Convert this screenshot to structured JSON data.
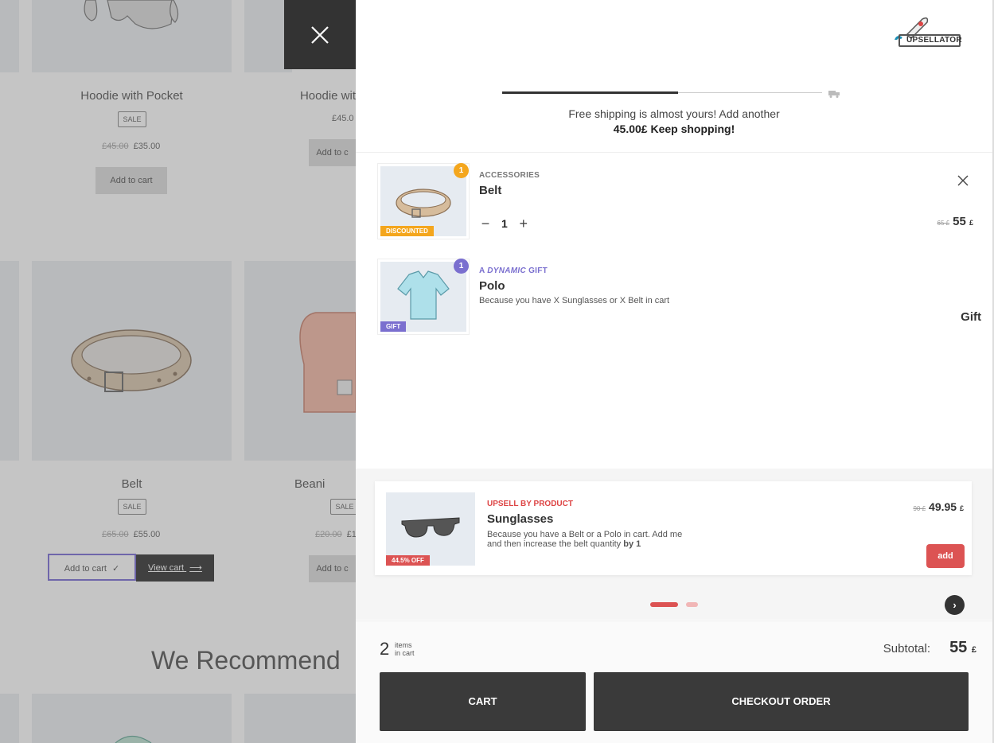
{
  "shop": {
    "products": [
      {
        "name": "Hoodie with Pocket",
        "badge": "SALE",
        "old_price": "£45.00",
        "price": "£35.00",
        "button": "Add to cart"
      },
      {
        "name": "Hoodie wit",
        "price": "£45.0",
        "button": "Add to c"
      },
      {
        "name": "Belt",
        "badge": "SALE",
        "old_price": "£65.00",
        "price": "£55.00",
        "button": "Add to cart",
        "view_button": "View cart"
      },
      {
        "name": "Beani",
        "badge": "SALE",
        "old_price": "£20.00",
        "price": "£1",
        "button": "Add to c"
      }
    ],
    "section_title": "We Recommend"
  },
  "drawer": {
    "logo_text": "UPSELLATOR",
    "shipping": {
      "progress": 0.55,
      "line1": "Free shipping is almost yours! Add another",
      "line2": "45.00£ Keep shopping!"
    },
    "items": [
      {
        "category": "ACCESSORIES",
        "name": "Belt",
        "qty": "1",
        "ribbon": "DISCOUNTED",
        "old_price": "65 £",
        "price": "55",
        "currency": "£",
        "badge": "1"
      },
      {
        "category_pre": "A ",
        "category_em": "DYNAMIC",
        "category_post": " GIFT",
        "name": "Polo",
        "desc": "Because you have X Sunglasses or X Belt in cart",
        "ribbon": "GIFT",
        "price": "Gift",
        "badge": "1"
      }
    ],
    "upsell": {
      "label": "UPSELL BY PRODUCT",
      "name": "Sunglasses",
      "desc": "Because you have a Belt or a Polo in cart. Add me and then increase the belt quantity ",
      "desc_bold": "by 1",
      "old_price": "90 £",
      "price": "49.95",
      "currency": "£",
      "ribbon": "44.5% OFF",
      "add_label": "add",
      "next_label": "›"
    },
    "footer": {
      "count": "2",
      "count_label_1": "items",
      "count_label_2": "in cart",
      "subtotal_label": "Subtotal:",
      "subtotal": "55",
      "currency": "£",
      "cart_label": "CART",
      "checkout_label": "CHECKOUT ORDER"
    }
  },
  "colors": {
    "accent_red": "#dc5353",
    "gift_purple": "#7a6fcf",
    "discount_orange": "#f4a61d",
    "dark": "#3a3a3a"
  }
}
